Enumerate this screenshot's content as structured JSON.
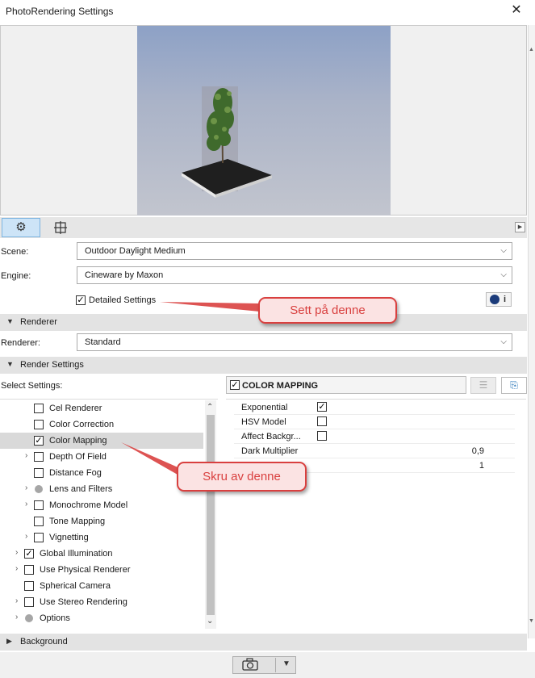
{
  "window": {
    "title": "PhotoRendering Settings",
    "close_icon": "close-icon"
  },
  "toolbar": {
    "settings_icon": "gear-icon",
    "crop_icon": "crop-icon",
    "play_icon": "play-icon"
  },
  "scene": {
    "label": "Scene:",
    "value": "Outdoor Daylight Medium"
  },
  "engine": {
    "label": "Engine:",
    "value": "Cineware by Maxon",
    "detailed_settings_label": "Detailed Settings",
    "detailed_settings_checked": true,
    "info_label": "i"
  },
  "sections": {
    "renderer": "Renderer",
    "render_settings": "Render Settings",
    "background": "Background"
  },
  "renderer": {
    "label": "Renderer:",
    "value": "Standard"
  },
  "select_settings_label": "Select Settings:",
  "tree": [
    {
      "label": "Cel Renderer",
      "checked": false,
      "indent": 1,
      "arrow": false,
      "dot": false
    },
    {
      "label": "Color Correction",
      "checked": false,
      "indent": 1,
      "arrow": false,
      "dot": false
    },
    {
      "label": "Color Mapping",
      "checked": true,
      "indent": 1,
      "arrow": false,
      "dot": false,
      "selected": true
    },
    {
      "label": "Depth Of Field",
      "checked": false,
      "indent": 1,
      "arrow": true,
      "dot": false
    },
    {
      "label": "Distance Fog",
      "checked": false,
      "indent": 1,
      "arrow": false,
      "dot": false
    },
    {
      "label": "Lens and Filters",
      "checked": false,
      "indent": 1,
      "arrow": true,
      "dot": true
    },
    {
      "label": "Monochrome Model",
      "checked": false,
      "indent": 1,
      "arrow": true,
      "dot": false
    },
    {
      "label": "Tone Mapping",
      "checked": false,
      "indent": 1,
      "arrow": false,
      "dot": false
    },
    {
      "label": "Vignetting",
      "checked": false,
      "indent": 1,
      "arrow": true,
      "dot": false
    },
    {
      "label": "Global Illumination",
      "checked": true,
      "indent": 0,
      "arrow": true,
      "dot": false
    },
    {
      "label": "Use Physical Renderer",
      "checked": false,
      "indent": 0,
      "arrow": true,
      "dot": false
    },
    {
      "label": "Spherical Camera",
      "checked": false,
      "indent": 0,
      "arrow": false,
      "dot": false
    },
    {
      "label": "Use Stereo Rendering",
      "checked": false,
      "indent": 0,
      "arrow": true,
      "dot": false
    },
    {
      "label": "Options",
      "checked": false,
      "indent": 0,
      "arrow": true,
      "dot": true
    }
  ],
  "color_mapping": {
    "header": "COLOR MAPPING",
    "header_checked": true,
    "properties": [
      {
        "label": "Exponential",
        "type": "checkbox",
        "checked": true
      },
      {
        "label": "HSV Model",
        "type": "checkbox",
        "checked": false
      },
      {
        "label": "Affect Backgr...",
        "type": "checkbox",
        "checked": false
      },
      {
        "label": "Dark Multiplier",
        "type": "value",
        "value": "0,9"
      },
      {
        "label": "",
        "type": "value",
        "value": "1"
      }
    ]
  },
  "callouts": {
    "set_on": "Sett på denne",
    "turn_off": "Skru av denne"
  },
  "annotation_color": "#d9403f",
  "bottom": {
    "camera_icon": "camera-icon"
  }
}
